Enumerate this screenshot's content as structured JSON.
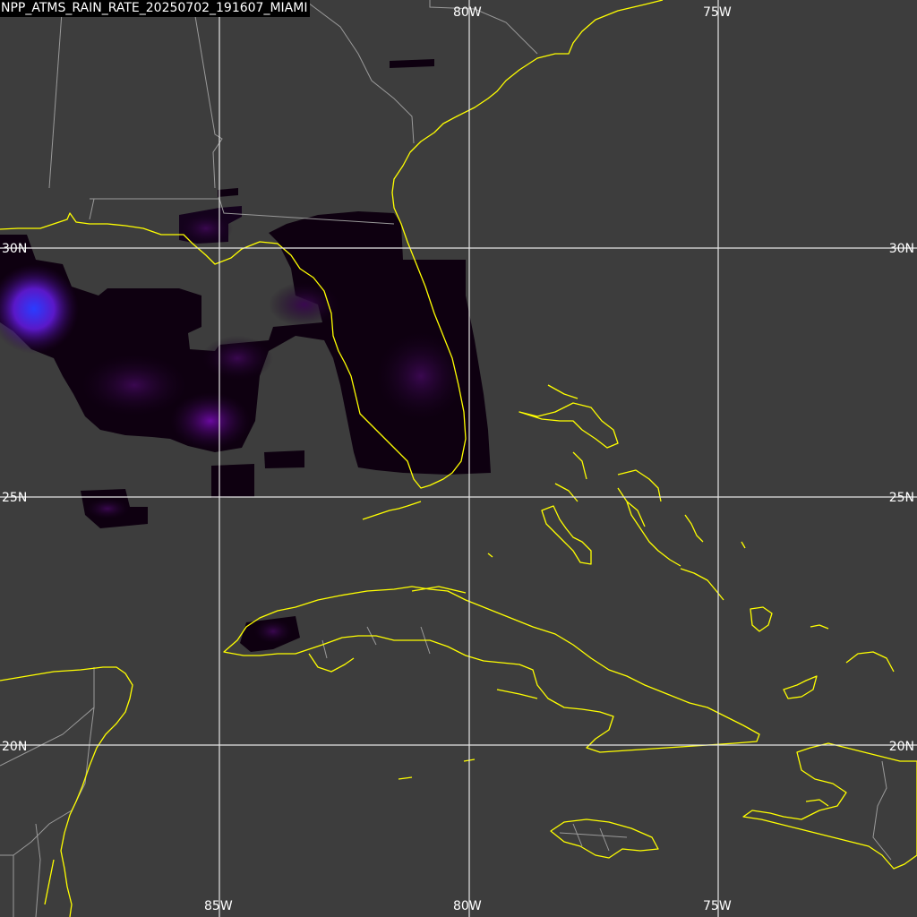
{
  "title": "NPP_ATMS_RAIN_RATE_20250702_191607_MIAMI",
  "longitude_labels": {
    "top": [
      "80W",
      "75W"
    ],
    "bottom": [
      "85W",
      "80W",
      "75W"
    ]
  },
  "latitude_labels": {
    "left": [
      "30N",
      "25N",
      "20N"
    ],
    "right": [
      "30N",
      "25N",
      "20N"
    ]
  },
  "colors": {
    "background": "#3d3d3d",
    "coastline": "#ffff00",
    "borders": "#9a9a9a",
    "gridlines": "#e6e6e6",
    "rain_low": "#0e0010",
    "rain_mid": "#5a0a8a",
    "rain_high": "#2a3cff"
  }
}
